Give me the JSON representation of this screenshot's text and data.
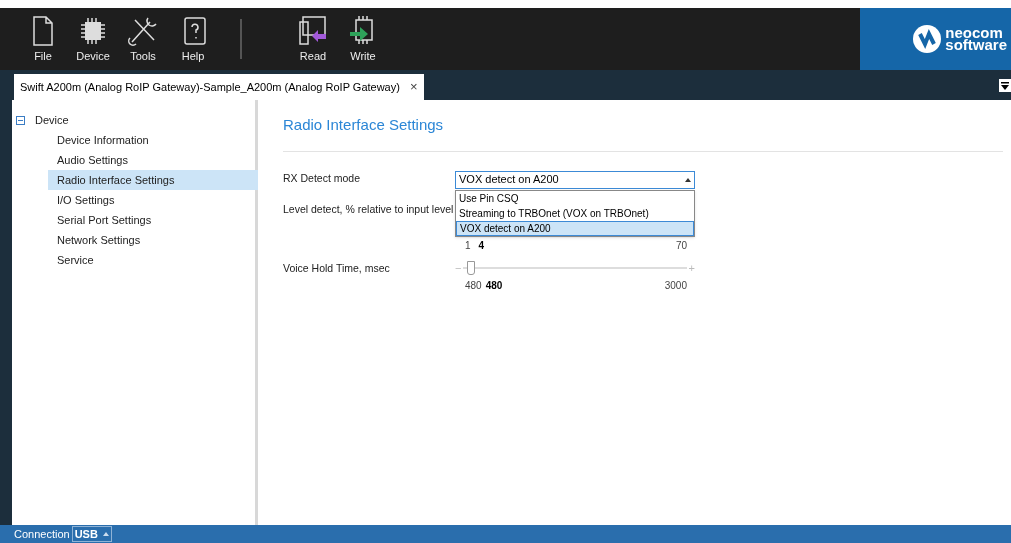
{
  "toolbar": {
    "buttons": [
      {
        "label": "File",
        "kind": "file"
      },
      {
        "label": "Device",
        "kind": "chip"
      },
      {
        "label": "Tools",
        "kind": "tools"
      },
      {
        "label": "Help",
        "kind": "help"
      },
      {
        "label": "Read",
        "kind": "read"
      },
      {
        "label": "Write",
        "kind": "write"
      }
    ]
  },
  "logo": {
    "line_1": "neocom",
    "line_2": "software"
  },
  "tabs": [
    {
      "label": "Swift A200m (Analog RoIP Gateway)-Sample_A200m (Analog RoIP Gateway)",
      "close": "×",
      "selected": true
    }
  ],
  "tree": {
    "label": "Device",
    "expanded": true,
    "children": [
      {
        "label": "Device Information",
        "selected": false
      },
      {
        "label": "Audio Settings",
        "selected": false
      },
      {
        "label": "Radio Interface Settings",
        "selected": true
      },
      {
        "label": "I/O Settings",
        "selected": false
      },
      {
        "label": "Serial Port Settings",
        "selected": false
      },
      {
        "label": "Network Settings",
        "selected": false
      },
      {
        "label": "Service",
        "selected": false
      }
    ]
  },
  "page": {
    "title": "Radio Interface Settings",
    "rx_detect": {
      "label": "RX Detect mode",
      "value": "VOX detect on A200",
      "expanded": true,
      "options": [
        {
          "label": "Use Pin CSQ",
          "selected": false
        },
        {
          "label": "Streaming to TRBOnet (VOX on TRBOnet)",
          "selected": false
        },
        {
          "label": "VOX detect on A200",
          "selected": true
        }
      ]
    },
    "level_detect": {
      "label": "Level detect, % relative to input level",
      "min": "1",
      "value": "4",
      "max": "70"
    },
    "voice_hold": {
      "label": "Voice Hold Time, msec",
      "minus": "−",
      "plus": "+",
      "level": 0,
      "min": "480",
      "value": "480",
      "max": "3000"
    }
  },
  "status_bar": {
    "label": "Connection",
    "value": "USB"
  }
}
